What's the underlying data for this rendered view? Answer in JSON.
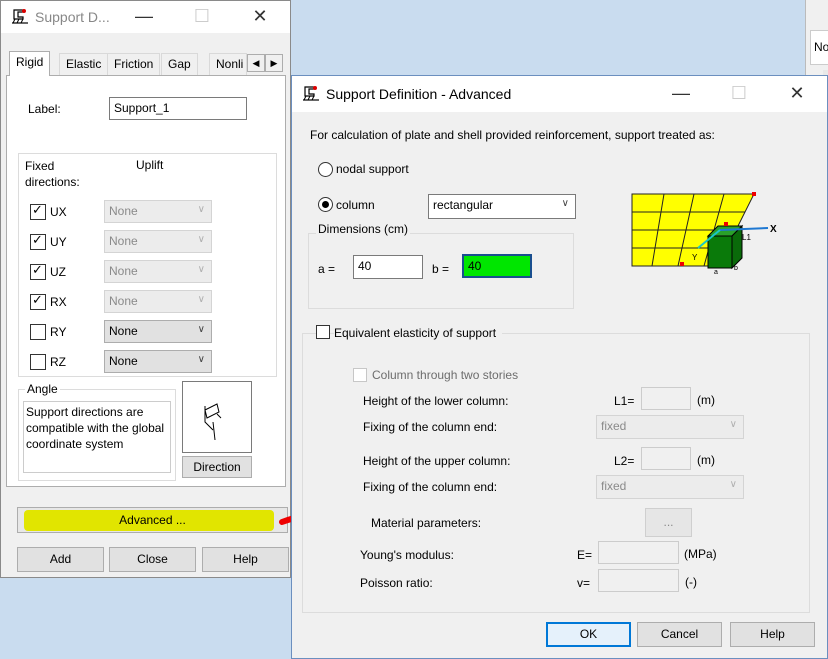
{
  "left_window": {
    "title": "Support D...",
    "tabs": [
      "Rigid",
      "Elastic",
      "Friction",
      "Gap",
      "Nonli"
    ],
    "label_caption": "Label:",
    "label_value": "Support_1",
    "fixed_directions_header": "Fixed\ndirections:",
    "uplift_header": "Uplift",
    "directions": [
      {
        "name": "UX",
        "checked": true,
        "uplift": "None"
      },
      {
        "name": "UY",
        "checked": true,
        "uplift": "None"
      },
      {
        "name": "UZ",
        "checked": true,
        "uplift": "None"
      },
      {
        "name": "RX",
        "checked": true,
        "uplift": "None"
      },
      {
        "name": "RY",
        "checked": false,
        "uplift": "None"
      },
      {
        "name": "RZ",
        "checked": false,
        "uplift": "None"
      }
    ],
    "angle_title": "Angle",
    "angle_text": "Support directions are compatible with the global coordinate system",
    "direction_button": "Direction",
    "advanced_button": "Advanced ...",
    "add_button": "Add",
    "close_button": "Close",
    "help_button": "Help",
    "highlight_color": "#e1e500"
  },
  "dialog": {
    "title": "Support Definition - Advanced",
    "intro": "For calculation of plate and shell provided reinforcement, support treated as:",
    "nodal_support": "nodal support",
    "column": "column",
    "column_shape": "rectangular",
    "dimensions_title": "Dimensions (cm)",
    "a_label": "a =",
    "a_value": "40",
    "b_label": "b =",
    "b_value": "40",
    "b_highlight": "#00e600",
    "equivalent_elasticity": "Equivalent elasticity of support",
    "two_stories": "Column through two stories",
    "lower_height": "Height of the lower column:",
    "l1": "L1=",
    "unit_m": "(m)",
    "fixing_end": "Fixing of the column end:",
    "fixed": "fixed",
    "upper_height": "Height of the upper column:",
    "l2": "L2=",
    "material_params": "Material parameters:",
    "material_btn": "...",
    "youngs": "Young's modulus:",
    "e_label": "E=",
    "e_unit": "(MPa)",
    "poisson": "Poisson ratio:",
    "v_label": "v=",
    "v_unit": "(-)",
    "ok": "OK",
    "cancel": "Cancel",
    "help": "Help",
    "diagram_labels": {
      "x": "X",
      "y": "Y",
      "l1": "L1",
      "a": "a",
      "b": "b"
    }
  },
  "background_window": {
    "fragment": "No"
  }
}
